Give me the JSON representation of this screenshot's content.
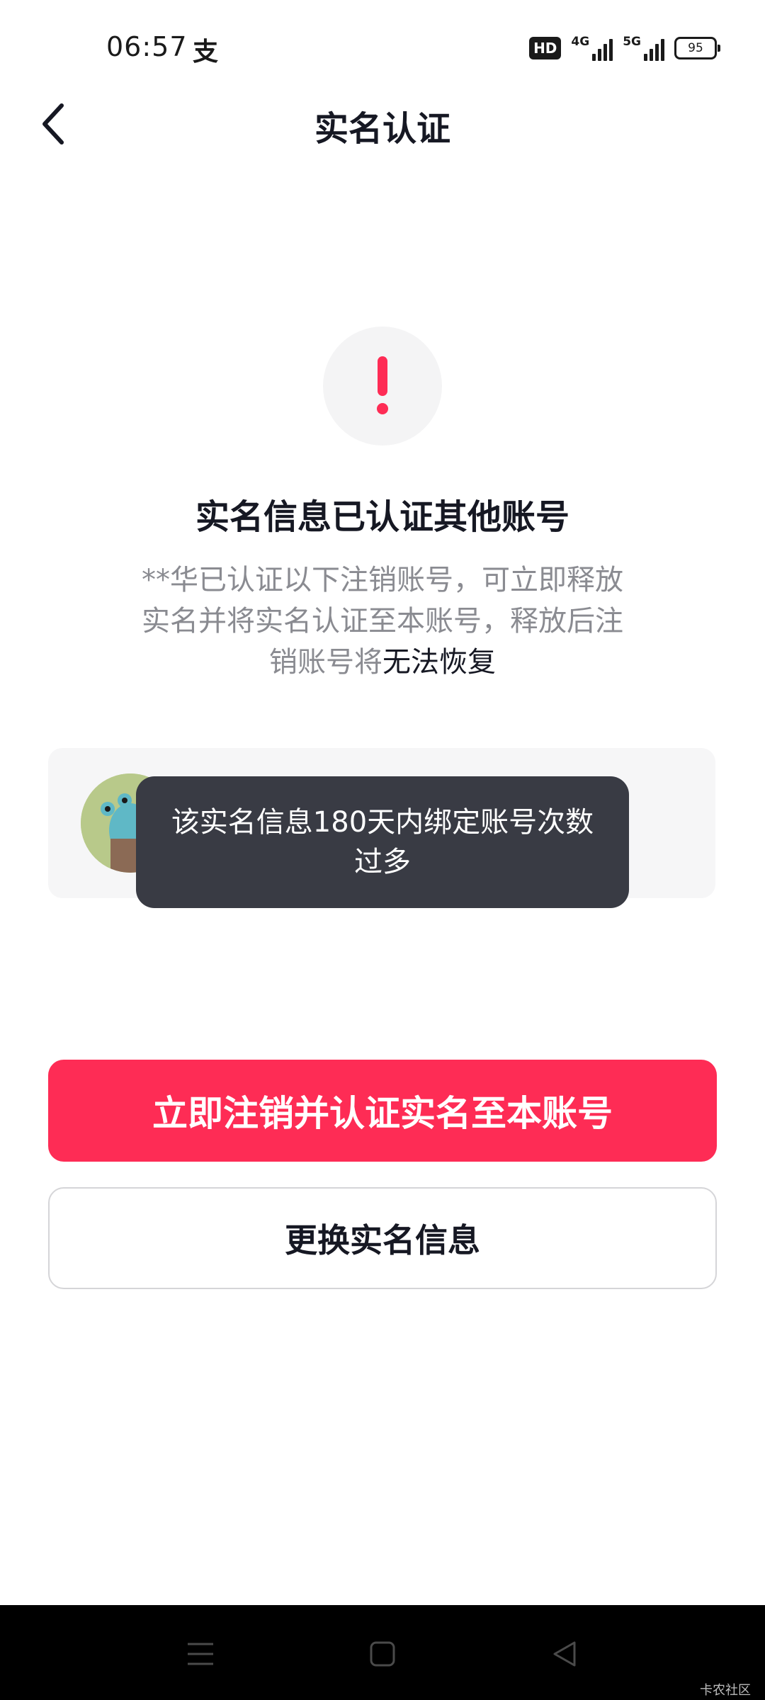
{
  "status_bar": {
    "time": "06:57",
    "app_indicator": "支",
    "hd_label": "HD",
    "signal1_label": "4G",
    "signal2_label": "5G",
    "battery": "95"
  },
  "header": {
    "title": "实名认证",
    "back_icon": "chevron-left-icon"
  },
  "warning": {
    "icon": "exclamation-icon",
    "accent_color": "#fe2c55"
  },
  "headline": "实名信息已认证其他账号",
  "description": {
    "text": "**华已认证以下注销账号，可立即释放实名并将实名认证至本账号，释放后注销账号将",
    "emphasis": "无法恢复"
  },
  "toast": {
    "message": "该实名信息180天内绑定账号次数过多"
  },
  "buttons": {
    "primary_label": "立即注销并认证实名至本账号",
    "secondary_label": "更换实名信息"
  },
  "nav": {
    "menu_icon": "menu-icon",
    "home_icon": "home-square-icon",
    "back_icon": "back-triangle-icon"
  },
  "watermark": "卡农社区",
  "colors": {
    "primary": "#fe2c55",
    "toast_bg": "#393b44"
  }
}
